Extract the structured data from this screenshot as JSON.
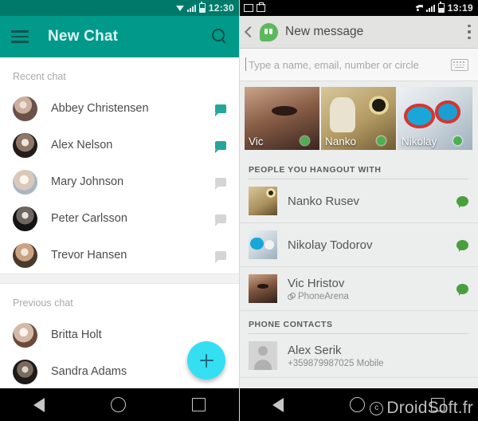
{
  "left_screen": {
    "status_bar": {
      "time": "12:30",
      "icons": [
        "data-triangle-icon",
        "signal-icon",
        "battery-icon"
      ]
    },
    "app_bar": {
      "title": "New Chat",
      "menu_icon": "hamburger-menu-icon",
      "search_icon": "search-icon",
      "background_color": "#00998a",
      "title_color": "#dff6f2"
    },
    "sections": [
      {
        "label": "Recent chat",
        "rows": [
          {
            "name": "Abbey Christensen",
            "bubble": "teal"
          },
          {
            "name": "Alex Nelson",
            "bubble": "teal"
          },
          {
            "name": "Mary Johnson",
            "bubble": "gray"
          },
          {
            "name": "Peter Carlsson",
            "bubble": "gray"
          },
          {
            "name": "Trevor Hansen",
            "bubble": "gray"
          }
        ]
      },
      {
        "label": "Previous chat",
        "rows": [
          {
            "name": "Britta Holt",
            "bubble": "none"
          },
          {
            "name": "Sandra Adams",
            "bubble": "none"
          }
        ]
      }
    ],
    "fab": {
      "icon": "plus-icon",
      "color": "#35dff2"
    },
    "nav_bar": {
      "back": "back-icon",
      "home": "home-icon",
      "recents": "recents-icon"
    }
  },
  "right_screen": {
    "status_bar": {
      "time": "13:19",
      "left_icons": [
        "screenshot-icon",
        "app-update-icon"
      ],
      "right_icons": [
        "wifi-icon",
        "signal-icon",
        "battery-icon"
      ]
    },
    "app_bar": {
      "title": "New message",
      "back_icon": "back-chevron-icon",
      "logo": "hangouts-logo-icon",
      "overflow_icon": "overflow-menu-icon"
    },
    "recipient_input": {
      "placeholder": "Type a name, email, number or circle",
      "value": "",
      "keyboard_icon": "keyboard-icon"
    },
    "tiles": [
      {
        "name": "Vic",
        "status": "online"
      },
      {
        "name": "Nanko",
        "status": "online"
      },
      {
        "name": "Nikolay",
        "status": "online"
      }
    ],
    "sections": [
      {
        "label": "PEOPLE YOU HANGOUT WITH",
        "rows": [
          {
            "name": "Nanko Rusev",
            "subtitle": "",
            "presence": "online"
          },
          {
            "name": "Nikolay Todorov",
            "subtitle": "",
            "presence": "online"
          },
          {
            "name": "Vic Hristov",
            "subtitle": "PhoneArena",
            "presence": "online"
          }
        ]
      },
      {
        "label": "PHONE CONTACTS",
        "rows": [
          {
            "name": "Alex Serik",
            "subtitle": "+359879987025 Mobile",
            "presence": "none"
          }
        ]
      }
    ],
    "nav_bar": {
      "back": "back-icon",
      "home": "home-icon",
      "recents": "recents-icon"
    }
  },
  "watermark": {
    "text": "DroidSoft.fr",
    "mark": "c"
  }
}
